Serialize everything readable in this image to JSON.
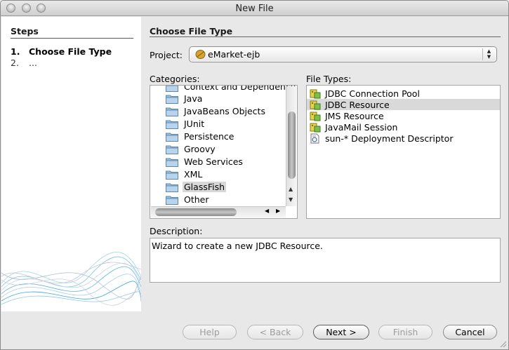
{
  "window": {
    "title": "New File"
  },
  "steps": {
    "title": "Steps",
    "items": [
      {
        "num": "1.",
        "label": "Choose File Type"
      },
      {
        "num": "2.",
        "label": "..."
      }
    ]
  },
  "main": {
    "section_title": "Choose File Type",
    "project_label": "Project:",
    "project_value": "eMarket-ejb",
    "categories_label": "Categories:",
    "categories": [
      "Context and Dependency Injection",
      "Java",
      "JavaBeans Objects",
      "JUnit",
      "Persistence",
      "Groovy",
      "Web Services",
      "XML",
      "GlassFish",
      "Other"
    ],
    "selected_category": "GlassFish",
    "file_types_label": "File Types:",
    "file_types": [
      "JDBC Connection Pool",
      "JDBC Resource",
      "JMS Resource",
      "JavaMail Session",
      "sun-* Deployment Descriptor"
    ],
    "selected_file_type": "JDBC Resource",
    "description_label": "Description:",
    "description": "Wizard to create a new JDBC Resource."
  },
  "buttons": {
    "help": "Help",
    "back": "< Back",
    "next": "Next >",
    "finish": "Finish",
    "cancel": "Cancel"
  }
}
